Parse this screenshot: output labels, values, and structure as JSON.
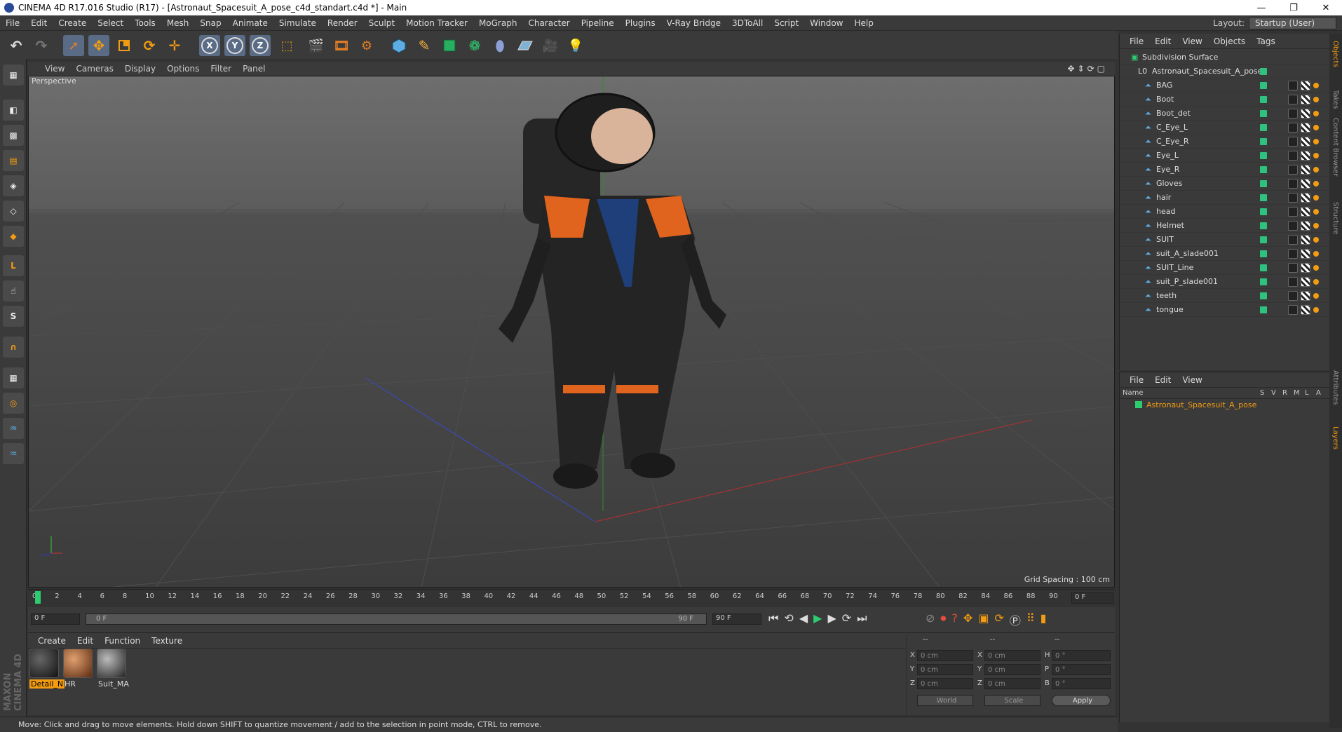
{
  "window": {
    "title": "CINEMA 4D R17.016 Studio (R17) - [Astronaut_Spacesuit_A_pose_c4d_standart.c4d *] - Main"
  },
  "menu": [
    "File",
    "Edit",
    "Create",
    "Select",
    "Tools",
    "Mesh",
    "Snap",
    "Animate",
    "Simulate",
    "Render",
    "Sculpt",
    "Motion Tracker",
    "MoGraph",
    "Character",
    "Pipeline",
    "Plugins",
    "V-Ray Bridge",
    "3DToAll",
    "Script",
    "Window",
    "Help"
  ],
  "layout": {
    "label": "Layout:",
    "value": "Startup (User)"
  },
  "toolbar": {
    "x_label": "X",
    "y_label": "Y",
    "z_label": "Z"
  },
  "viewport": {
    "menu": [
      "View",
      "Cameras",
      "Display",
      "Options",
      "Filter",
      "Panel"
    ],
    "label": "Perspective",
    "grid_spacing": "Grid Spacing : 100 cm"
  },
  "timeline": {
    "ticks": [
      "0",
      "2",
      "4",
      "6",
      "8",
      "10",
      "12",
      "14",
      "16",
      "18",
      "20",
      "22",
      "24",
      "26",
      "28",
      "30",
      "32",
      "34",
      "36",
      "38",
      "40",
      "42",
      "44",
      "46",
      "48",
      "50",
      "52",
      "54",
      "56",
      "58",
      "60",
      "62",
      "64",
      "66",
      "68",
      "70",
      "72",
      "74",
      "76",
      "78",
      "80",
      "82",
      "84",
      "86",
      "88",
      "90"
    ],
    "current_frame": "0 F"
  },
  "transport": {
    "start": "0 F",
    "range_start": "0 F",
    "range_end": "90 F",
    "end": "90 F"
  },
  "materials": {
    "menu": [
      "Create",
      "Edit",
      "Function",
      "Texture"
    ],
    "items": [
      {
        "label": "Detail_N",
        "color": "#2b2b2b"
      },
      {
        "label": "HR",
        "color": "#b06a3a"
      },
      {
        "label": "Suit_MA",
        "color": "#555555"
      }
    ]
  },
  "coords": {
    "headers": [
      "--",
      "--",
      "--"
    ],
    "rows": [
      {
        "a": "X",
        "av": "0 cm",
        "b": "X",
        "bv": "0 cm",
        "c": "H",
        "cv": "0 °"
      },
      {
        "a": "Y",
        "av": "0 cm",
        "b": "Y",
        "bv": "0 cm",
        "c": "P",
        "cv": "0 °"
      },
      {
        "a": "Z",
        "av": "0 cm",
        "b": "Z",
        "bv": "0 cm",
        "c": "B",
        "cv": "0 °"
      }
    ],
    "world": "World",
    "scale": "Scale",
    "apply": "Apply"
  },
  "status": "Move: Click and drag to move elements. Hold down SHIFT to quantize movement / add to the selection in point mode, CTRL to remove.",
  "brand": "MAXON CINEMA 4D",
  "objects": {
    "menu": [
      "File",
      "Edit",
      "View",
      "Objects",
      "Tags"
    ],
    "root": "Subdivision Surface",
    "group": "Astronaut_Spacesuit_A_pose",
    "items": [
      "BAG",
      "Boot",
      "Boot_det",
      "C_Eye_L",
      "C_Eye_R",
      "Eye_L",
      "Eye_R",
      "Gloves",
      "hair",
      "head",
      "Helmet",
      "SUIT",
      "suit_A_slade001",
      "SUIT_Line",
      "suit_P_slade001",
      "teeth",
      "tongue"
    ]
  },
  "layers": {
    "menu": [
      "File",
      "Edit",
      "View"
    ],
    "name_header": "Name",
    "cols": [
      "S",
      "V",
      "R",
      "M",
      "L",
      "A"
    ],
    "item": "Astronaut_Spacesuit_A_pose"
  },
  "sidetabs": [
    "Objects",
    "Takes",
    "Content Browser",
    "Structure",
    "Attributes",
    "Layers"
  ]
}
